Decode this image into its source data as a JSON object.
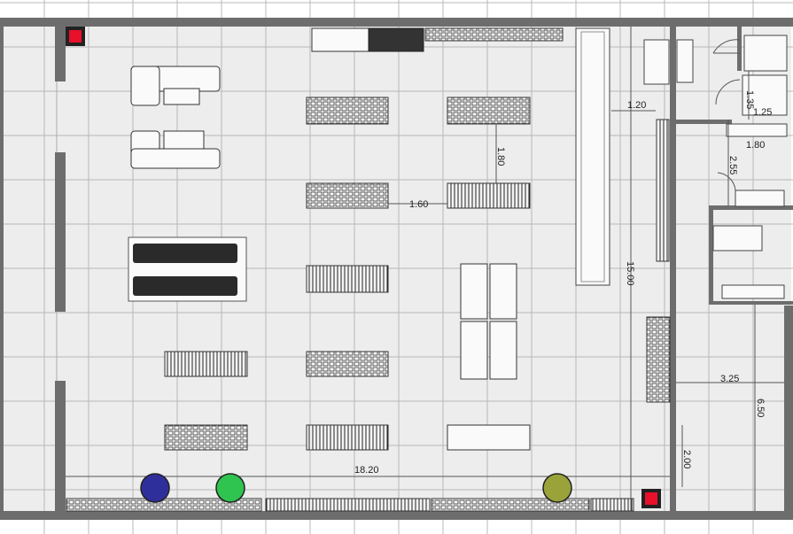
{
  "plan": {
    "dimensions": {
      "d1": "1.20",
      "d2": "1.80",
      "d3": "1.60",
      "d4": "15.00",
      "d5": "1.25",
      "d6": "1.80",
      "d7": "2.55",
      "d8": "3.25",
      "d9": "6.50",
      "d10": "2.00",
      "d11": "18.20",
      "d12": "1.35"
    },
    "colors": {
      "wall": "#6d6d6d",
      "floor": "#ededed",
      "grid": "#b8b8b8",
      "marker_red": "#e8102a",
      "marker_blue": "#2f2f9c",
      "marker_green": "#2ec44f",
      "marker_olive": "#9aa33a"
    }
  }
}
